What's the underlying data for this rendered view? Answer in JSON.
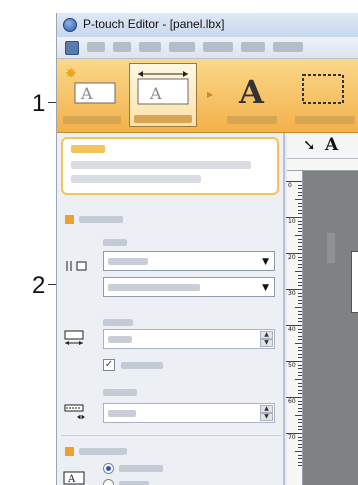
{
  "callouts": [
    {
      "label": "1"
    },
    {
      "label": "2"
    }
  ],
  "window": {
    "title": "P-touch Editor - [panel.lbx]"
  },
  "ribbon": {
    "buttons": [
      "new-object",
      "paper",
      "text",
      "frame"
    ]
  },
  "canvas": {
    "toolbar": {
      "text_tool_glyph": "A",
      "pointer_glyph": "➘"
    },
    "vruler": [
      "0",
      "10",
      "20",
      "30",
      "40",
      "50",
      "60",
      "70"
    ]
  },
  "colors": {
    "ribbon": "#f3b14a",
    "accent": "#f0a030",
    "panel": "#eceff4",
    "canvas": "#7f8183"
  },
  "icons": [
    "app-icon",
    "menu-icon",
    "new-object-icon",
    "paper-icon",
    "text-icon",
    "frame-icon",
    "pointer-icon",
    "text-tool-icon",
    "tape-icon",
    "length-icon",
    "margin-icon",
    "orientation-icon",
    "checkbox-check-icon"
  ]
}
